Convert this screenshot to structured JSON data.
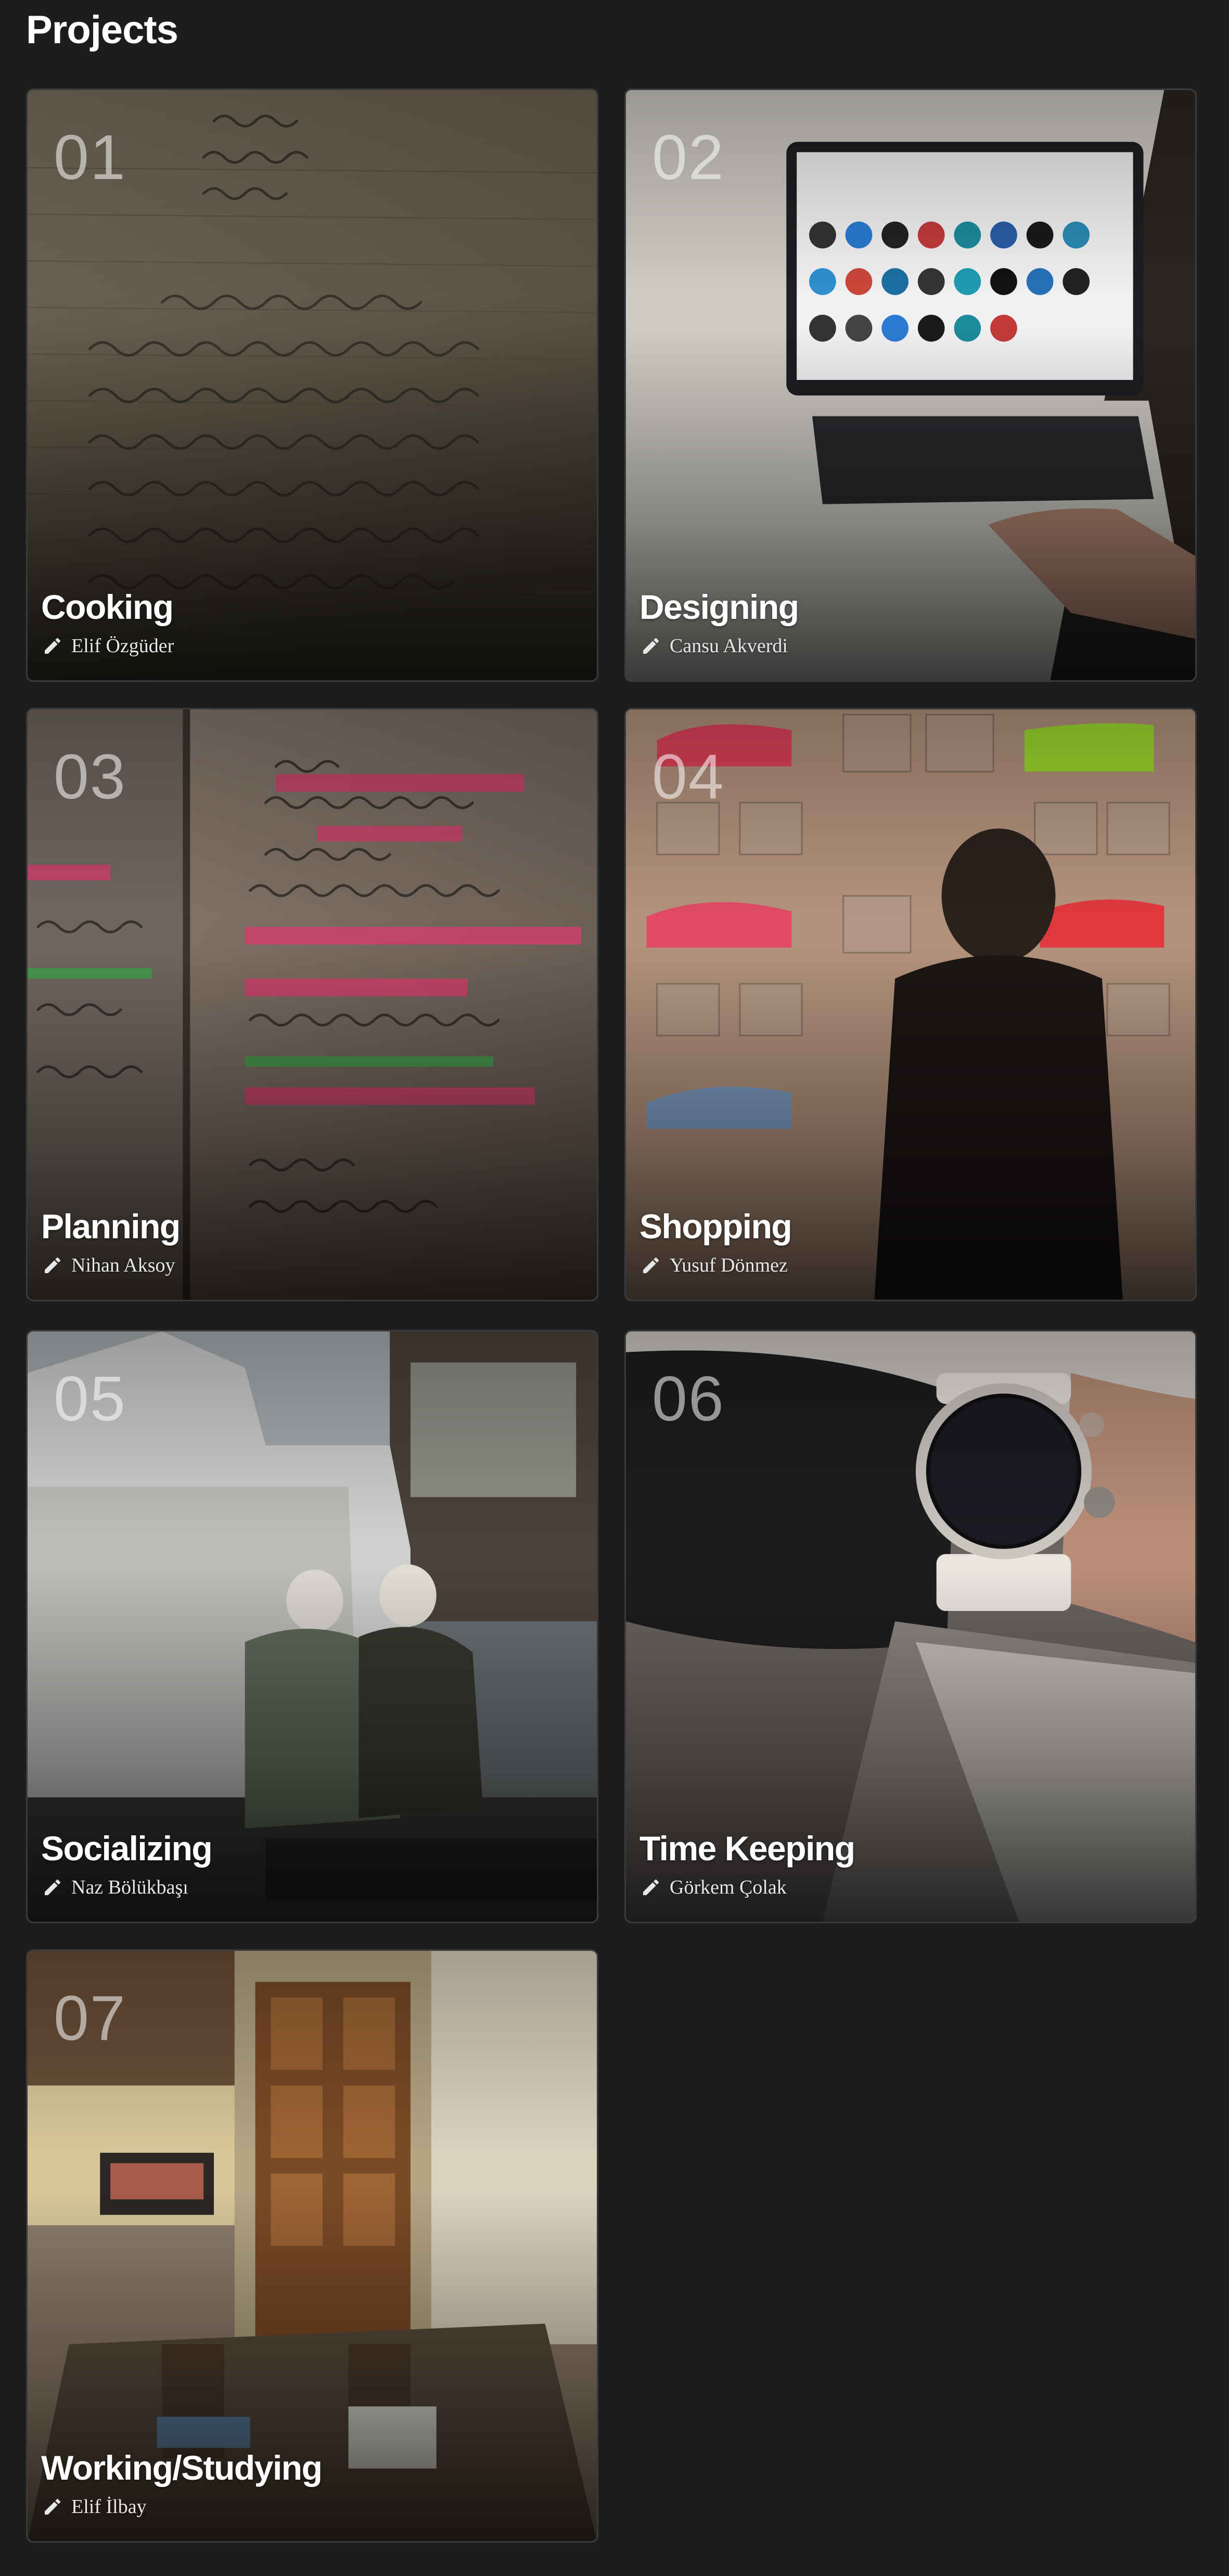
{
  "header": {
    "title": "Projects"
  },
  "projects": [
    {
      "number": "01",
      "title": "Cooking",
      "author": "Elif Özgüder",
      "icon": "pencil-icon"
    },
    {
      "number": "02",
      "title": "Designing",
      "author": "Cansu Akverdi",
      "icon": "pencil-icon"
    },
    {
      "number": "03",
      "title": "Planning",
      "author": "Nihan Aksoy",
      "icon": "pencil-icon"
    },
    {
      "number": "04",
      "title": "Shopping",
      "author": "Yusuf Dönmez",
      "icon": "pencil-icon"
    },
    {
      "number": "05",
      "title": "Socializing",
      "author": "Naz Bölükbaşı",
      "icon": "pencil-icon"
    },
    {
      "number": "06",
      "title": "Time Keeping",
      "author": "Görkem Çolak",
      "icon": "pencil-icon"
    },
    {
      "number": "07",
      "title": "Working/Studying",
      "author": "Elif İlbay",
      "icon": "pencil-icon"
    }
  ],
  "colors": {
    "background": "#1d1d1d",
    "card_border": "#3a3a3a",
    "title_text": "#ffffff",
    "number_text": "#ffffff8c"
  }
}
